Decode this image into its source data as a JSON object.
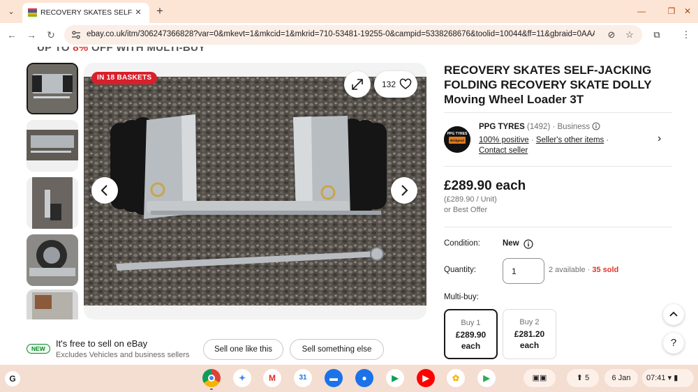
{
  "browser": {
    "tab_title": "RECOVERY SKATES SELF-JACKI",
    "url": "ebay.co.uk/itm/306247366828?var=0&mkevt=1&mkcid=1&mkrid=710-53481-19255-0&campid=5338268676&toolid=10044&ff=11&gbraid=0AAAADA..."
  },
  "page": {
    "promo_prefix": "UP TO ",
    "promo_highlight": "8%",
    "promo_suffix": " OFF WITH MULTI-BUY",
    "basket_badge": "IN 18 BASKETS",
    "watch_count": "132",
    "item_title": "RECOVERY SKATES SELF-JACKING FOLDING RECOVERY SKATE DOLLY Moving Wheel Loader 3T",
    "seller": {
      "name": "PPG TYRES",
      "feedback_count": "(1492)",
      "type": "Business",
      "positive": "100% positive",
      "other_items": "Seller's other items",
      "contact": "Contact seller",
      "logo_text_1": "PPG TYRES",
      "logo_text_2": "Bridgend"
    },
    "price": "£289.90 each",
    "unit_price": "(£289.90 / Unit)",
    "best_offer": "or Best Offer",
    "condition_label": "Condition:",
    "condition_value": "New",
    "quantity_label": "Quantity:",
    "quantity_value": "1",
    "available": "2 available",
    "sold": "35 sold",
    "multibuy_label": "Multi-buy:",
    "multibuy": [
      {
        "qty": "Buy 1",
        "price": "£289.90",
        "each": "each"
      },
      {
        "qty": "Buy 2",
        "price": "£281.20",
        "each": "each"
      }
    ],
    "sell_badge": "NEW",
    "sell_title": "It's free to sell on eBay",
    "sell_sub": "Excludes Vehicles and business sellers",
    "sell_one_btn": "Sell one like this",
    "sell_else_btn": "Sell something else"
  },
  "shelf": {
    "date": "6 Jan",
    "time": "07:41",
    "notif_count": "5",
    "launcher": "G"
  },
  "colors": {
    "tabstrip": "#fde5d6",
    "accent_red": "#e0322b",
    "shelf": "#f4ddd1"
  }
}
